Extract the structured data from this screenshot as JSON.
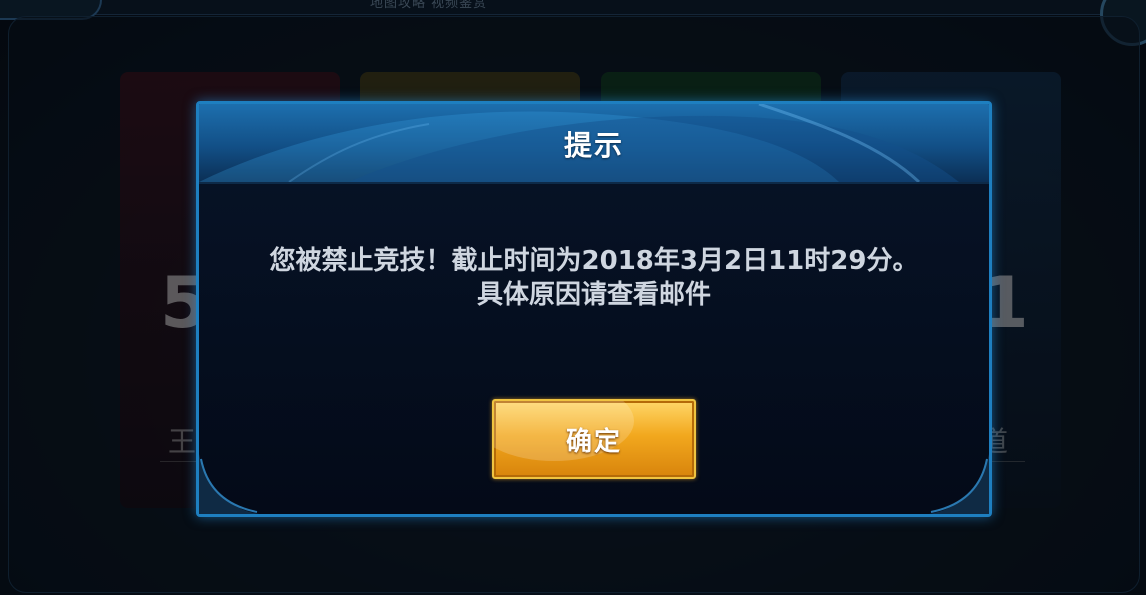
{
  "dialog": {
    "title": "提示",
    "message_line1": "您被禁止竞技！截止时间为2018年3月2日11时29分。",
    "message_line2": "具体原因请查看邮件",
    "confirm_label": "确定"
  },
  "background": {
    "top_text": "地图攻略  视频鉴赏",
    "card_left_number": "5",
    "card_right_number": "1",
    "card_left_label": "王",
    "card_right_label": "道"
  },
  "colors": {
    "dialog_border": "#1e7fc0",
    "header_blue": "#1d6fae",
    "button_gold": "#f2a81e",
    "message_text": "#cfd6e0"
  }
}
